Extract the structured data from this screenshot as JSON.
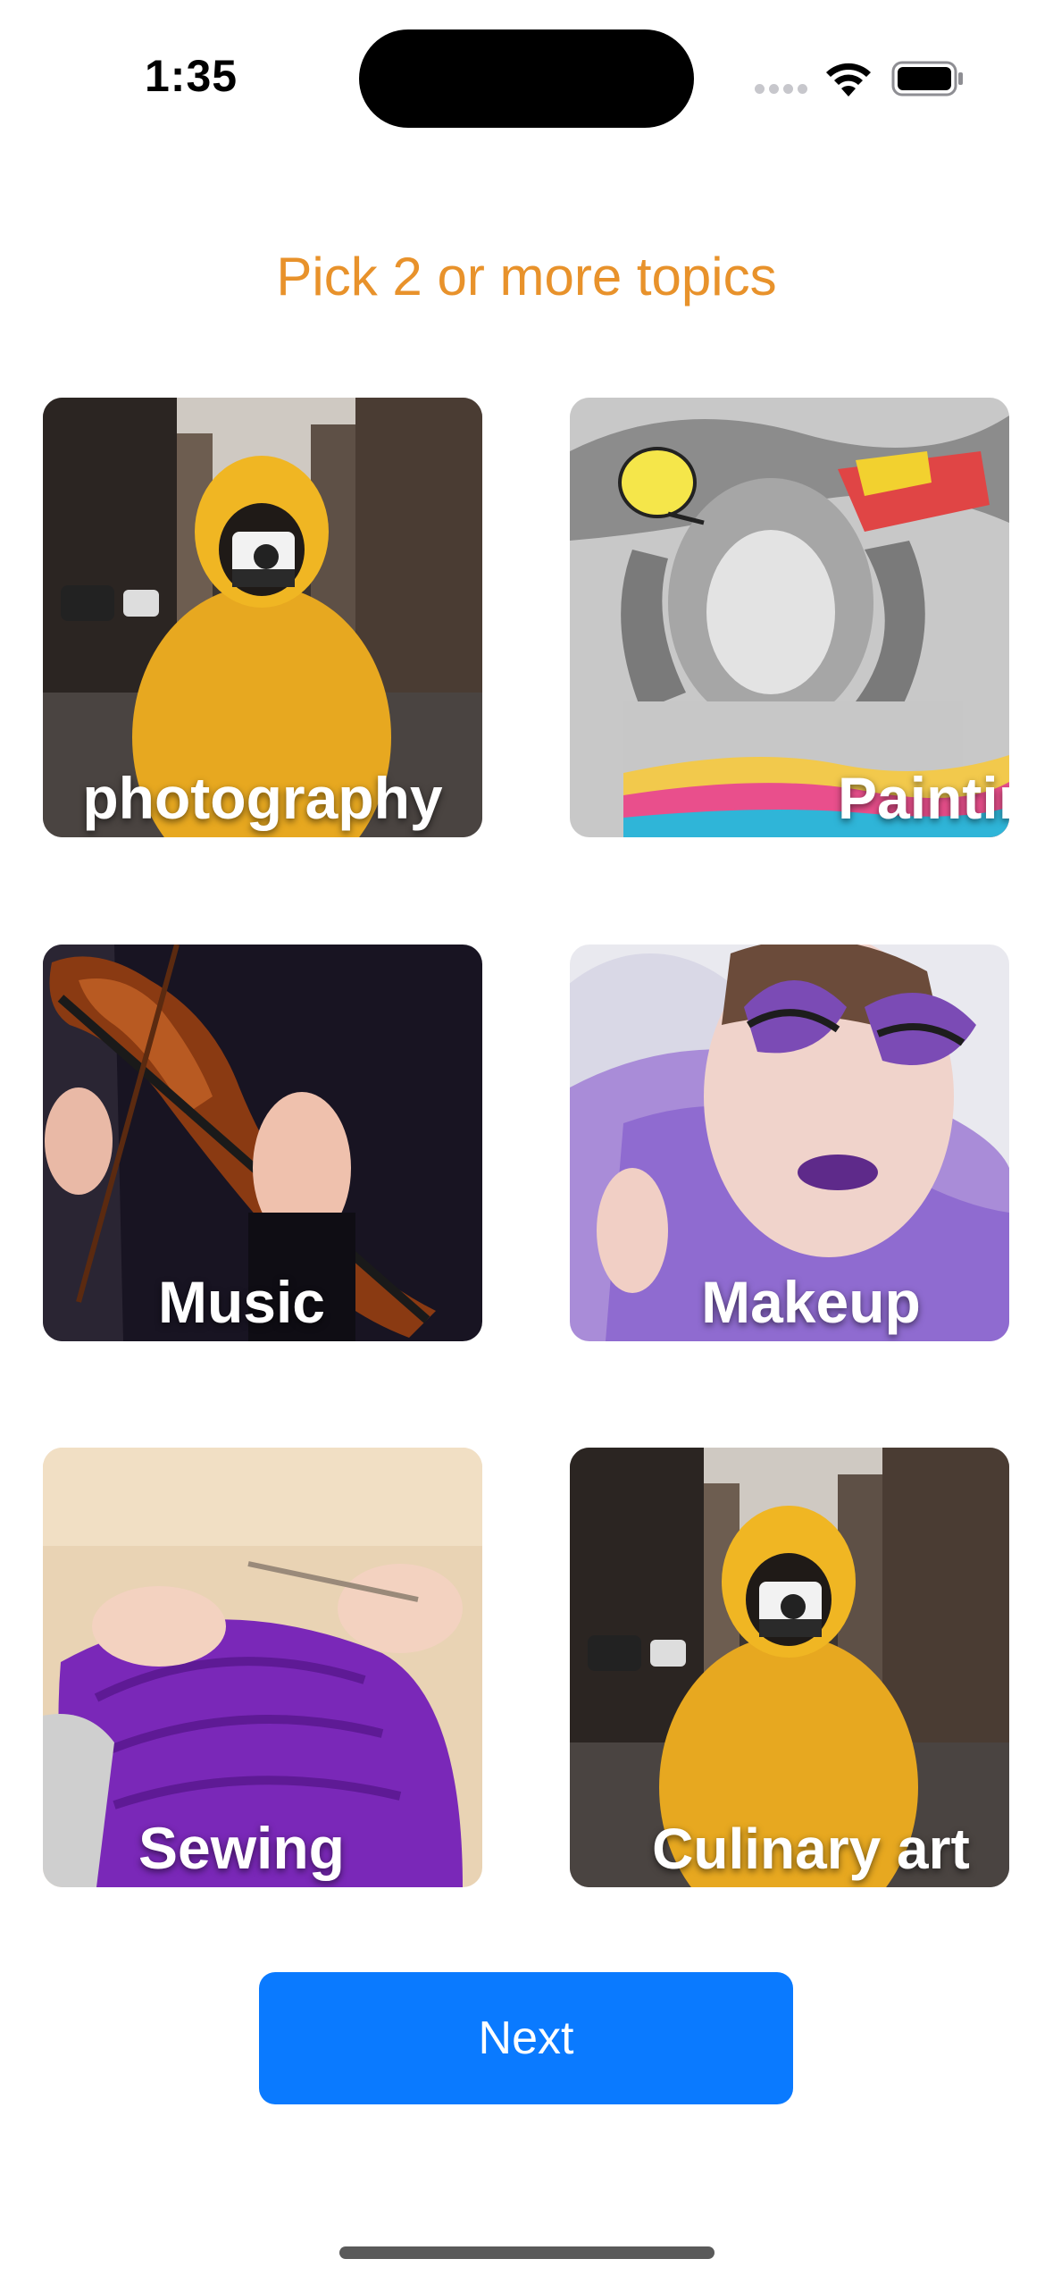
{
  "status_bar": {
    "time": "1:35"
  },
  "title": "Pick 2 or more topics",
  "topics": [
    {
      "label": "photography"
    },
    {
      "label": "Painting"
    },
    {
      "label": "Music"
    },
    {
      "label": "Makeup"
    },
    {
      "label": "Sewing"
    },
    {
      "label": "Culinary art"
    }
  ],
  "next_label": "Next",
  "colors": {
    "title": "#e8922b",
    "button": "#0a7aff"
  }
}
